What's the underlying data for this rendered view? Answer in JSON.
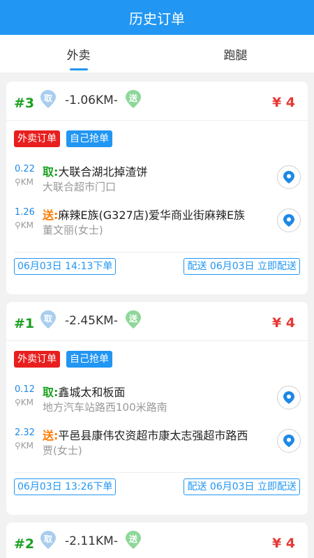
{
  "header": {
    "title": "历史订单"
  },
  "tabs": [
    {
      "label": "外卖"
    },
    {
      "label": "跑腿"
    }
  ],
  "colors": {
    "primary": "#2196f3",
    "price": "#e53935",
    "pickup": "#19a01e",
    "deliver": "#ff7a00"
  },
  "orders": [
    {
      "number": "#3",
      "pickup_badge": "取",
      "distance": "-1.06KM-",
      "deliver_badge": "送",
      "price": "¥ 4",
      "tags": [
        "外卖订单",
        "自己抢单"
      ],
      "pickup": {
        "km": "0.22",
        "unit": "KM",
        "kind": "取:",
        "name": "大联合湖北掉渣饼",
        "address": "大联合超市门口"
      },
      "deliver": {
        "km": "1.26",
        "unit": "KM",
        "kind": "送:",
        "name": "麻辣E族(G327店)爱华商业街麻辣E族",
        "address": "董文丽(女士)"
      },
      "order_time": "06月03日 14:13下单",
      "delivery_time": "配送 06月03日 立即配送"
    },
    {
      "number": "#1",
      "pickup_badge": "取",
      "distance": "-2.45KM-",
      "deliver_badge": "送",
      "price": "¥ 4",
      "tags": [
        "外卖订单",
        "自己抢单"
      ],
      "pickup": {
        "km": "0.12",
        "unit": "KM",
        "kind": "取:",
        "name": "鑫城太和板面",
        "address": "地方汽车站路西100米路南"
      },
      "deliver": {
        "km": "2.32",
        "unit": "KM",
        "kind": "送:",
        "name": "平邑县康伟农资超市康太志强超市路西",
        "address": "贾(女士)"
      },
      "order_time": "06月03日 13:26下单",
      "delivery_time": "配送 06月03日 立即配送"
    },
    {
      "number": "#2",
      "pickup_badge": "取",
      "distance": "-2.11KM-",
      "deliver_badge": "送",
      "price": "¥ 4"
    }
  ]
}
